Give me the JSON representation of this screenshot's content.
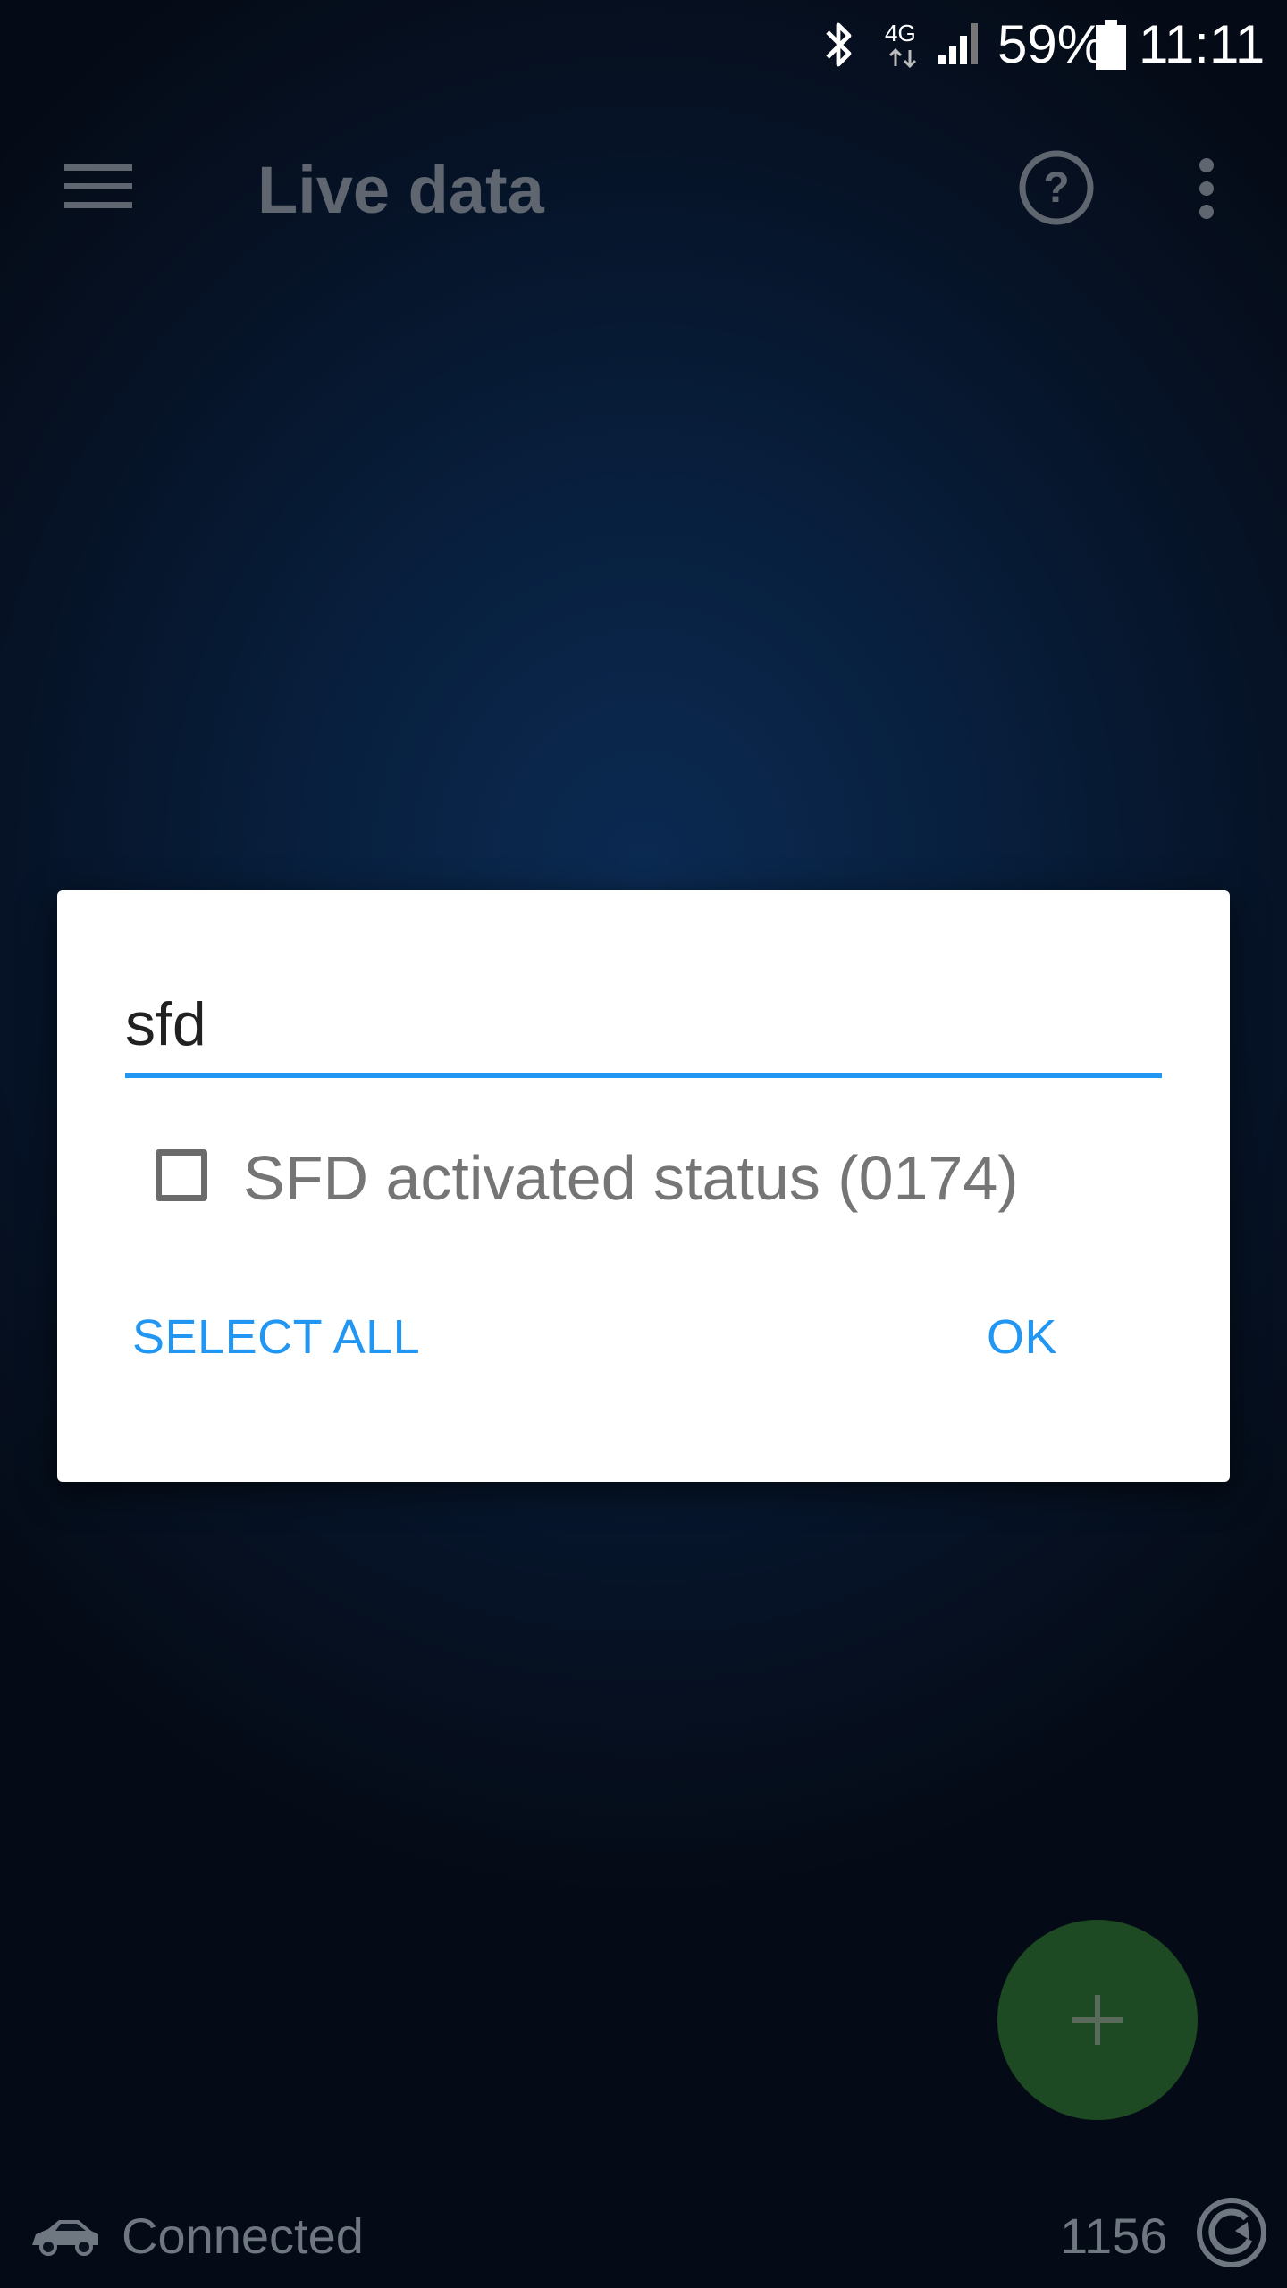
{
  "status_bar": {
    "network": "4G",
    "battery": "59%",
    "time": "11:11"
  },
  "app_bar": {
    "title": "Live data"
  },
  "dialog": {
    "search_value": "sfd",
    "options": [
      {
        "label": "SFD activated status (0174)",
        "checked": false
      }
    ],
    "select_all_label": "SELECT ALL",
    "ok_label": "OK"
  },
  "footer": {
    "connection_status": "Connected",
    "counter": "1156"
  },
  "colors": {
    "accent": "#2196f3",
    "fab": "#1d4a22"
  }
}
